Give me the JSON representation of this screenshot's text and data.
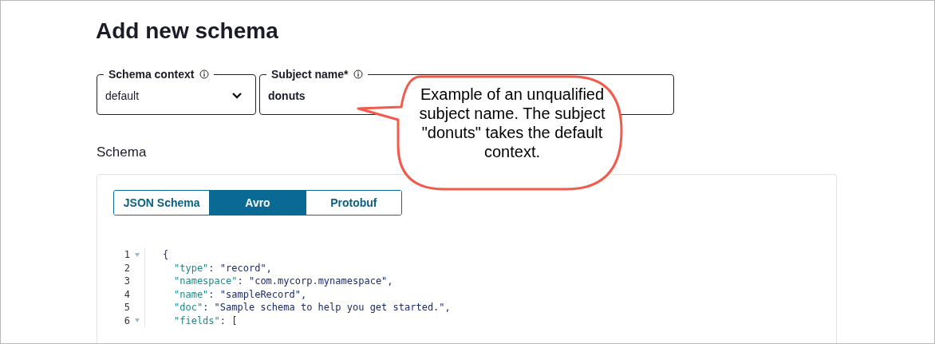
{
  "title": "Add new schema",
  "fields": [
    {
      "kind": "select",
      "label": "Schema context",
      "value": "default"
    },
    {
      "kind": "text",
      "label": "Subject name*",
      "value": "donuts"
    }
  ],
  "section": "Schema",
  "tabs": [
    {
      "label": "JSON Schema",
      "selected": false
    },
    {
      "label": "Avro",
      "selected": true
    },
    {
      "label": "Protobuf",
      "selected": false
    }
  ],
  "code": [
    {
      "number": "1",
      "foldable": true,
      "rest": "{"
    },
    {
      "number": "2",
      "foldable": false,
      "key": "\"type\"",
      "rest": ": \"record\","
    },
    {
      "number": "3",
      "foldable": false,
      "key": "\"namespace\"",
      "rest": ": \"com.mycorp.mynamespace\","
    },
    {
      "number": "4",
      "foldable": false,
      "key": "\"name\"",
      "rest": ": \"sampleRecord\","
    },
    {
      "number": "5",
      "foldable": false,
      "key": "\"doc\"",
      "rest": ": \"Sample schema to help you get started.\","
    },
    {
      "number": "6",
      "foldable": true,
      "key": "\"fields\"",
      "rest": ": ["
    }
  ],
  "callout": "Example of an unqualified subject name. The subject \"donuts\" takes the default context."
}
